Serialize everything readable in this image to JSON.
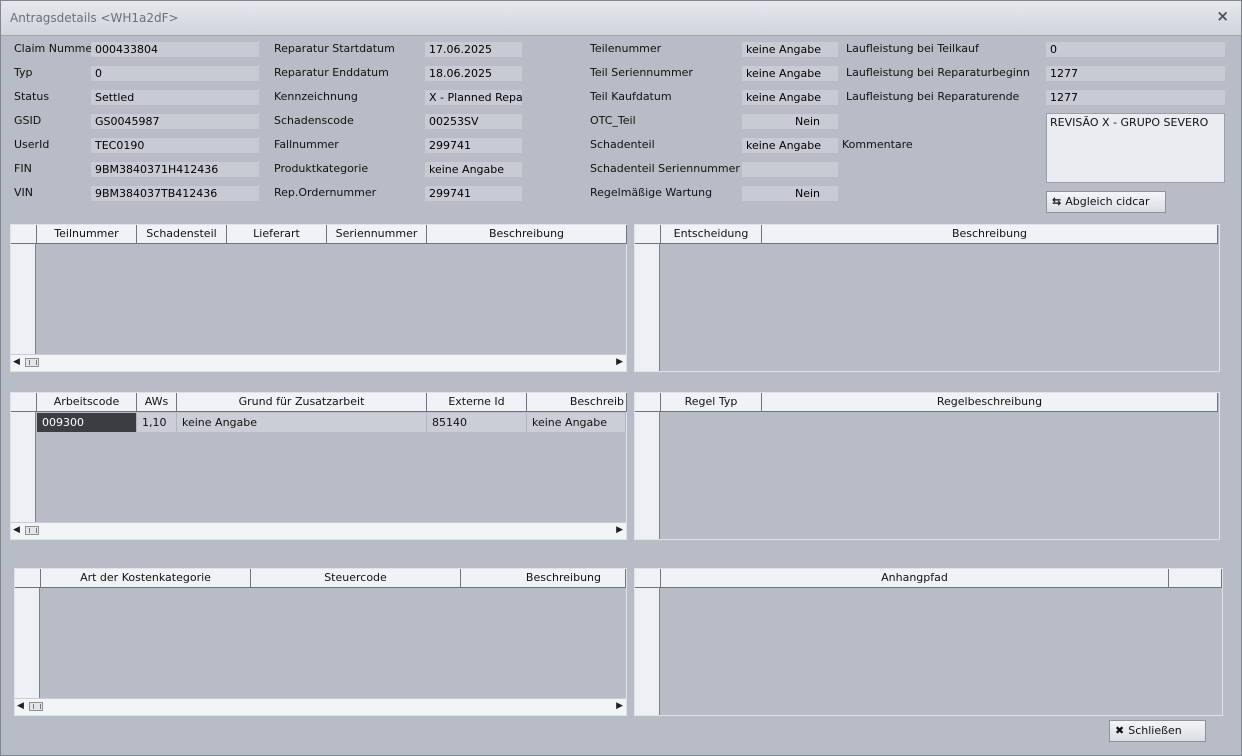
{
  "window": {
    "title": "Antragsdetails <WH1a2dF>",
    "close_symbol": "×"
  },
  "fields": {
    "claim_nummer": {
      "label": "Claim Nummer",
      "value": "000433804"
    },
    "typ": {
      "label": "Typ",
      "value": "0"
    },
    "status": {
      "label": "Status",
      "value": "Settled"
    },
    "gsid": {
      "label": "GSID",
      "value": "GS0045987"
    },
    "userid": {
      "label": "UserId",
      "value": "TEC0190"
    },
    "fin": {
      "label": "FIN",
      "value": "9BM3840371H412436"
    },
    "vin": {
      "label": "VIN",
      "value": "9BM384037TB412436"
    },
    "rep_start": {
      "label": "Reparatur Startdatum",
      "value": "17.06.2025"
    },
    "rep_end": {
      "label": "Reparatur Enddatum",
      "value": "18.06.2025"
    },
    "kennzeichnung": {
      "label": "Kennzeichnung",
      "value": "X - Planned Repair"
    },
    "schadenscode": {
      "label": "Schadenscode",
      "value": "00253SV"
    },
    "fallnummer": {
      "label": "Fallnummer",
      "value": "299741"
    },
    "produktkategorie": {
      "label": "Produktkategorie",
      "value": "keine Angabe"
    },
    "rep_ordernummer": {
      "label": "Rep.Ordernummer",
      "value": "299741"
    },
    "teilenummer": {
      "label": "Teilenummer",
      "value": "keine Angabe"
    },
    "teil_seriennummer": {
      "label": "Teil Seriennummer",
      "value": "keine Angabe"
    },
    "teil_kaufdatum": {
      "label": "Teil Kaufdatum",
      "value": "keine Angabe"
    },
    "otc_teil": {
      "label": "OTC_Teil",
      "value": "Nein"
    },
    "schadenteil": {
      "label": "Schadenteil",
      "value": "keine Angabe"
    },
    "schadenteil_seriennummer": {
      "label": "Schadenteil Seriennummer",
      "value": ""
    },
    "regelmaessige_wartung": {
      "label": "Regelmäßige Wartung",
      "value": "Nein"
    },
    "laufleistung_teilkauf": {
      "label": "Laufleistung bei Teilkauf",
      "value": "0"
    },
    "laufleistung_rep_beginn": {
      "label": "Laufleistung bei Reparaturbeginn",
      "value": "1277"
    },
    "laufleistung_rep_ende": {
      "label": "Laufleistung bei Reparaturende",
      "value": "1277"
    },
    "kommentare": {
      "label": "Kommentare",
      "value": "REVISÃO X - GRUPO SEVERO"
    }
  },
  "buttons": {
    "abgleich": {
      "label": "Abgleich cidcar",
      "icon": "sync-icon"
    },
    "schliessen": {
      "label": "Schließen",
      "icon": "close-icon"
    }
  },
  "grids": {
    "teile": {
      "columns": [
        "Teilnummer",
        "Schadensteil",
        "Lieferart",
        "Seriennummer",
        "Beschreibung"
      ],
      "rows": []
    },
    "entscheidung": {
      "columns": [
        "Entscheidung",
        "Beschreibung"
      ],
      "rows": []
    },
    "arbeit": {
      "columns": [
        "Arbeitscode",
        "AWs",
        "Grund für Zusatzarbeit",
        "Externe Id",
        "Beschreib"
      ],
      "rows": [
        [
          "009300",
          "1,10",
          "keine Angabe",
          "85140",
          "keine Angabe"
        ]
      ]
    },
    "regel": {
      "columns": [
        "Regel Typ",
        "Regelbeschreibung"
      ],
      "rows": []
    },
    "kosten": {
      "columns": [
        "Art der Kostenkategorie",
        "Steuercode",
        "Beschreibung"
      ],
      "rows": []
    },
    "anhang": {
      "columns": [
        "Anhangpfad",
        ""
      ],
      "rows": []
    }
  },
  "scroll_arrows": {
    "left": "◀",
    "right": "▶"
  }
}
